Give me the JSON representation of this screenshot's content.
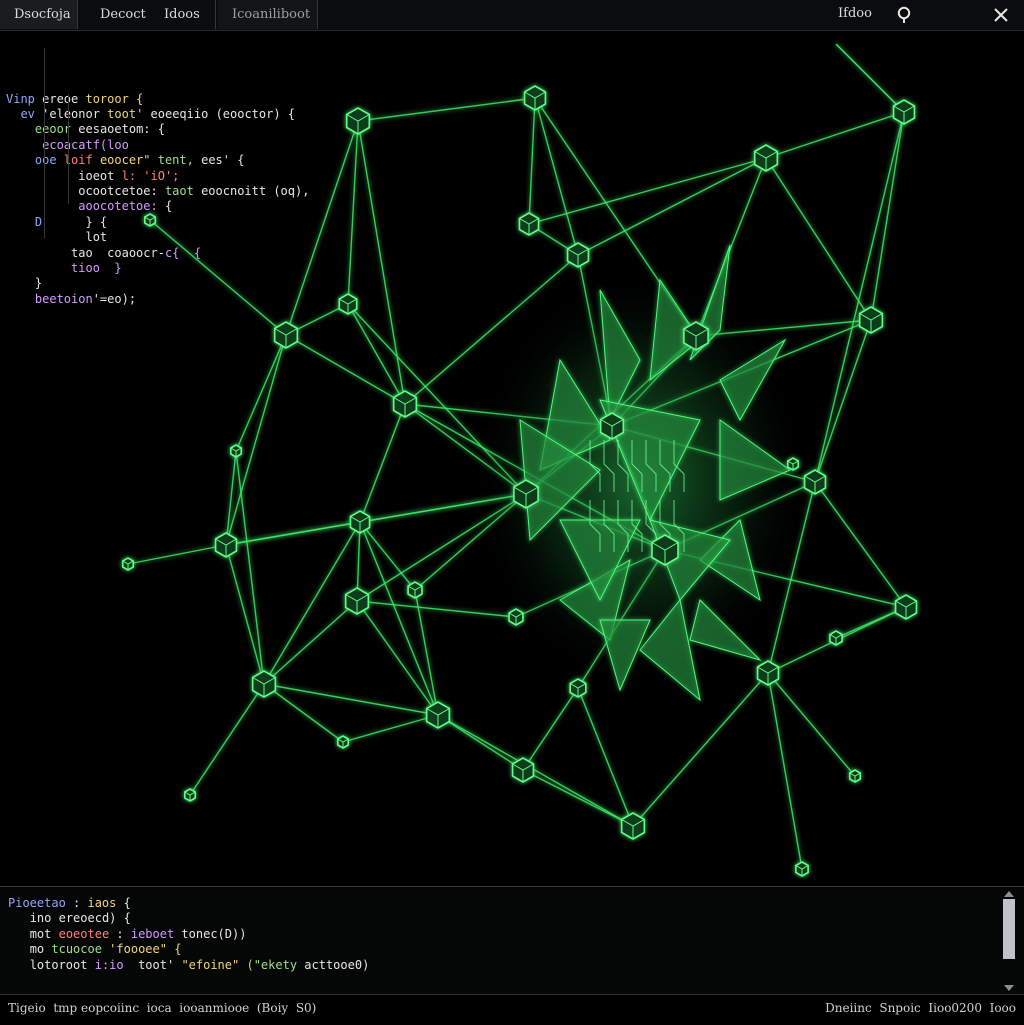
{
  "tabs": [
    "Dsocfoja",
    "Decoct",
    "Idoos",
    "Icoaniliboot"
  ],
  "top_label": "Ifdoo",
  "code_top": [
    [
      {
        "t": "Vinp ",
        "c": "blue"
      },
      {
        "t": "ereoe ",
        "c": "white"
      },
      {
        "t": "toroor {",
        "c": "yellow"
      }
    ],
    [
      {
        "t": "  ",
        "c": "white"
      },
      {
        "t": "ev ",
        "c": "blue"
      },
      {
        "t": "'eleonor ",
        "c": "white"
      },
      {
        "t": "toot' ",
        "c": "yellow"
      },
      {
        "t": "eoeeqiio ",
        "c": "white"
      },
      {
        "t": "(eooctor) {",
        "c": "white"
      }
    ],
    [
      {
        "t": "    ",
        "c": "white"
      },
      {
        "t": "eeoor ",
        "c": "green"
      },
      {
        "t": "eesaoetom: {",
        "c": "white"
      }
    ],
    [
      {
        "t": "     ",
        "c": "white"
      },
      {
        "t": "ecoacatf(loo",
        "c": "purple"
      }
    ],
    [
      {
        "t": "    ",
        "c": "white"
      },
      {
        "t": "ooe ",
        "c": "blue"
      },
      {
        "t": "loif ",
        "c": "red"
      },
      {
        "t": "eoocer\" ",
        "c": "yellow"
      },
      {
        "t": "tent, ",
        "c": "green"
      },
      {
        "t": "ees' {",
        "c": "white"
      }
    ],
    [
      {
        "t": "          ",
        "c": "white"
      },
      {
        "t": "ioeot ",
        "c": "white"
      },
      {
        "t": "l: 'iO';",
        "c": "red"
      }
    ],
    [
      {
        "t": "          ",
        "c": "white"
      },
      {
        "t": "ocootcetoe: ",
        "c": "white"
      },
      {
        "t": "taot ",
        "c": "green"
      },
      {
        "t": "eoocnoitt ",
        "c": "white"
      },
      {
        "t": "(oq),",
        "c": "white"
      }
    ],
    [
      {
        "t": "          ",
        "c": "white"
      },
      {
        "t": "aoocotetoe: ",
        "c": "purple"
      },
      {
        "t": "{",
        "c": "white"
      }
    ],
    [
      {
        "t": "    ",
        "c": "white"
      },
      {
        "t": "D      ",
        "c": "blue"
      },
      {
        "t": "} {",
        "c": "white"
      }
    ],
    [
      {
        "t": "           ",
        "c": "white"
      },
      {
        "t": "lot",
        "c": "white"
      }
    ],
    [
      {
        "t": "         ",
        "c": "white"
      },
      {
        "t": "tao  ",
        "c": "white"
      },
      {
        "t": "coaoocr-",
        "c": "white"
      },
      {
        "t": "c{  {",
        "c": "purple"
      }
    ],
    [
      {
        "t": "         ",
        "c": "white"
      },
      {
        "t": "tioo  }",
        "c": "purple"
      }
    ],
    [
      {
        "t": "    ",
        "c": "white"
      },
      {
        "t": "}",
        "c": "white"
      }
    ],
    [
      {
        "t": "    ",
        "c": "white"
      },
      {
        "t": "beetoion",
        "c": "purple"
      },
      {
        "t": "'=eo);",
        "c": "white"
      }
    ]
  ],
  "console_code": [
    [
      {
        "t": "Pioeetao ",
        "c": "blue"
      },
      {
        "t": ": ",
        "c": "white"
      },
      {
        "t": "iaos ",
        "c": "yellow"
      },
      {
        "t": "{",
        "c": "white"
      }
    ],
    [
      {
        "t": "   ",
        "c": "white"
      },
      {
        "t": "ino ",
        "c": "white"
      },
      {
        "t": "ereoecd) {",
        "c": "white"
      }
    ],
    [
      {
        "t": "   ",
        "c": "white"
      },
      {
        "t": "mot ",
        "c": "white"
      },
      {
        "t": "eoeotee ",
        "c": "red"
      },
      {
        "t": ": ",
        "c": "white"
      },
      {
        "t": "ieboet ",
        "c": "purple"
      },
      {
        "t": "tonec(D))",
        "c": "white"
      }
    ],
    [
      {
        "t": "   ",
        "c": "white"
      },
      {
        "t": "mo ",
        "c": "white"
      },
      {
        "t": "tcuocoe ",
        "c": "green"
      },
      {
        "t": "'foooee\" {",
        "c": "yellow"
      }
    ],
    [
      {
        "t": "   ",
        "c": "white"
      },
      {
        "t": "lotoroot ",
        "c": "white"
      },
      {
        "t": "i:io  ",
        "c": "purple"
      },
      {
        "t": "toot' ",
        "c": "white"
      },
      {
        "t": "\"efoine\" ",
        "c": "yellow"
      },
      {
        "t": "(\"ekety ",
        "c": "green"
      },
      {
        "t": "acttooe0)",
        "c": "white"
      }
    ]
  ],
  "status_left": "Tigeio  tmp eopcoiinc  ioca  iooanmiooe  (Boiy  S0)",
  "status_right": "Dneiinc  Snpoic  Iioo0200  Iooo",
  "colors": {
    "accent": "#39ff6a",
    "line": "#3de866",
    "background": "#000000"
  },
  "icons": {
    "search": "search-icon",
    "close": "close-icon"
  }
}
